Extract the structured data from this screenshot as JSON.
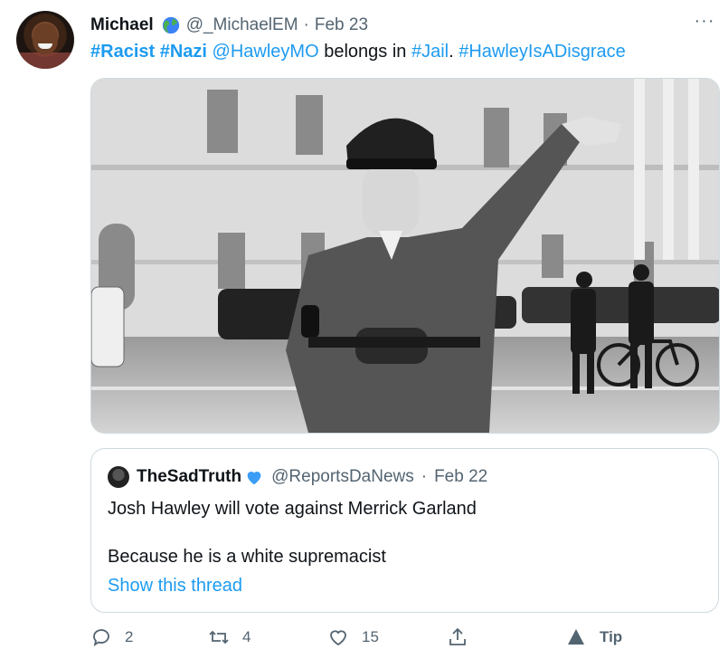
{
  "tweet": {
    "name": "Michael",
    "handle": "@_MichaelEM",
    "dot": "·",
    "date": "Feb 23",
    "more": "···",
    "text_parts": {
      "tag1": "#Racist",
      "tag2": "#Nazi",
      "mention": "@HawleyMO",
      "plain1": "belongs in",
      "tag3": "#Jail",
      "period": ".",
      "tag4": "#HawleyIsADisgrace"
    }
  },
  "quote": {
    "name": "TheSadTruth",
    "handle": "@ReportsDaNews",
    "dot": "·",
    "date": "Feb 22",
    "line1": "Josh Hawley will vote against Merrick Garland",
    "line2": "Because he is a white supremacist",
    "show_thread": "Show this thread"
  },
  "actions": {
    "replies": "2",
    "retweets": "4",
    "likes": "15",
    "tip": "Tip"
  },
  "colors": {
    "accent": "#1d9bf0",
    "secondary_text": "#536471",
    "border": "#cfd9de"
  },
  "icons": [
    "globe-icon",
    "more-icon",
    "blue-heart-icon",
    "reply-icon",
    "retweet-icon",
    "like-icon",
    "share-icon",
    "tip-icon"
  ]
}
